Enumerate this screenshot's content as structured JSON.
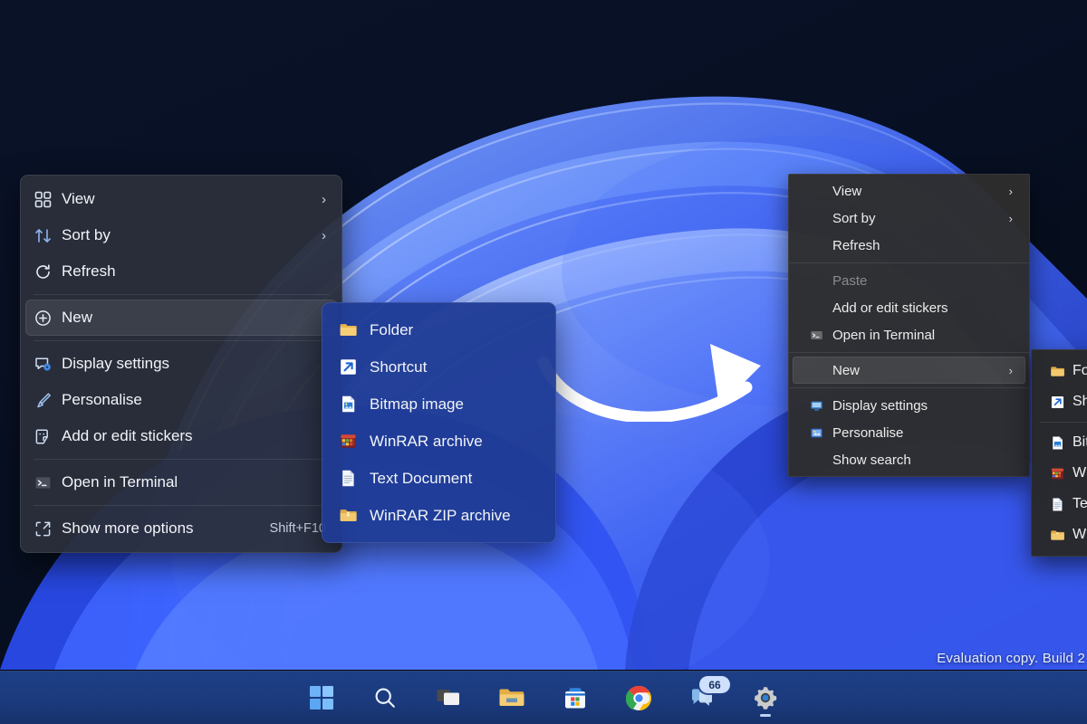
{
  "desktop": {
    "wallpaper_name": "windows-11-bloom-wallpaper",
    "watermark": "Evaluation copy. Build 2",
    "annotation_arrow": "curved-arrow-annotation"
  },
  "colors": {
    "menu_dark": "#2b2f3a",
    "menu_blue": "#1f3b93",
    "menu_classic": "#2d2d2d",
    "taskbar": "#1d3f86",
    "accent": "#4a7cf0",
    "text": "#f2f4f8",
    "disabled_text": "#8a8a8a",
    "folder_yellow": "#f5c257"
  },
  "context_menu": {
    "name": "desktop-context-menu",
    "groups": [
      {
        "items": [
          {
            "label": "View",
            "icon": "grid-view-icon",
            "submenu": true,
            "shortcut": "",
            "disabled": false,
            "selected": false
          },
          {
            "label": "Sort by",
            "icon": "sort-icon",
            "submenu": true,
            "shortcut": "",
            "disabled": false,
            "selected": false
          },
          {
            "label": "Refresh",
            "icon": "refresh-icon",
            "submenu": false,
            "shortcut": "",
            "disabled": false,
            "selected": false
          }
        ]
      },
      {
        "items": [
          {
            "label": "New",
            "icon": "plus-circle-icon",
            "submenu": true,
            "shortcut": "",
            "disabled": false,
            "selected": true
          }
        ]
      },
      {
        "items": [
          {
            "label": "Display settings",
            "icon": "monitor-settings-icon",
            "submenu": false,
            "shortcut": "",
            "disabled": false,
            "selected": false
          },
          {
            "label": "Personalise",
            "icon": "paintbrush-icon",
            "submenu": false,
            "shortcut": "",
            "disabled": false,
            "selected": false
          },
          {
            "label": "Add or edit stickers",
            "icon": "sticker-icon",
            "submenu": false,
            "shortcut": "",
            "disabled": false,
            "selected": false
          }
        ]
      },
      {
        "items": [
          {
            "label": "Open in Terminal",
            "icon": "terminal-icon",
            "submenu": false,
            "shortcut": "",
            "disabled": false,
            "selected": false
          }
        ]
      },
      {
        "items": [
          {
            "label": "Show more options",
            "icon": "show-more-options-icon",
            "submenu": false,
            "shortcut": "Shift+F10",
            "disabled": false,
            "selected": false
          }
        ]
      }
    ]
  },
  "new_submenu": {
    "name": "new-submenu",
    "items": [
      {
        "label": "Folder",
        "icon": "folder-icon"
      },
      {
        "label": "Shortcut",
        "icon": "shortcut-icon"
      },
      {
        "label": "Bitmap image",
        "icon": "bitmap-image-icon"
      },
      {
        "label": "WinRAR archive",
        "icon": "winrar-archive-icon"
      },
      {
        "label": "Text Document",
        "icon": "text-document-icon"
      },
      {
        "label": "WinRAR ZIP archive",
        "icon": "winrar-zip-icon"
      }
    ]
  },
  "classic_menu": {
    "name": "classic-context-menu",
    "groups": [
      {
        "items": [
          {
            "label": "View",
            "icon": "",
            "submenu": true,
            "disabled": false,
            "selected": false
          },
          {
            "label": "Sort by",
            "icon": "",
            "submenu": true,
            "disabled": false,
            "selected": false
          },
          {
            "label": "Refresh",
            "icon": "",
            "submenu": false,
            "disabled": false,
            "selected": false
          }
        ]
      },
      {
        "items": [
          {
            "label": "Paste",
            "icon": "",
            "submenu": false,
            "disabled": true,
            "selected": false
          },
          {
            "label": "Add or edit stickers",
            "icon": "",
            "submenu": false,
            "disabled": false,
            "selected": false
          },
          {
            "label": "Open in Terminal",
            "icon": "terminal-icon",
            "submenu": false,
            "disabled": false,
            "selected": false
          }
        ]
      },
      {
        "items": [
          {
            "label": "New",
            "icon": "",
            "submenu": true,
            "disabled": false,
            "selected": true
          }
        ]
      },
      {
        "items": [
          {
            "label": "Display settings",
            "icon": "monitor-settings-icon",
            "submenu": false,
            "disabled": false,
            "selected": false
          },
          {
            "label": "Personalise",
            "icon": "personalise-icon",
            "submenu": false,
            "disabled": false,
            "selected": false
          },
          {
            "label": "Show search",
            "icon": "",
            "submenu": false,
            "disabled": false,
            "selected": false
          }
        ]
      }
    ]
  },
  "classic_new_submenu": {
    "name": "classic-new-submenu",
    "items": [
      {
        "label": "Folder",
        "icon": "folder-icon"
      },
      {
        "label": "Shortcut",
        "icon": "shortcut-icon"
      },
      {
        "label": "Bitmap image",
        "icon": "bitmap-image-icon"
      },
      {
        "label": "WinRAR archive",
        "icon": "winrar-archive-icon"
      },
      {
        "label": "Text Document",
        "icon": "text-document-icon"
      },
      {
        "label": "WinRAR ZIP archive",
        "icon": "winrar-zip-icon"
      }
    ]
  },
  "taskbar": {
    "name": "taskbar",
    "items": [
      {
        "icon": "windows-start-icon",
        "label": "Start",
        "badge": "",
        "running": false
      },
      {
        "icon": "search-icon",
        "label": "Search",
        "badge": "",
        "running": false
      },
      {
        "icon": "task-view-icon",
        "label": "Task View",
        "badge": "",
        "running": false
      },
      {
        "icon": "file-explorer-icon",
        "label": "File Explorer",
        "badge": "",
        "running": false
      },
      {
        "icon": "microsoft-store-icon",
        "label": "Microsoft Store",
        "badge": "",
        "running": false
      },
      {
        "icon": "chrome-icon",
        "label": "Google Chrome",
        "badge": "",
        "running": false
      },
      {
        "icon": "teams-chat-icon",
        "label": "Chat",
        "badge": "66",
        "running": false
      },
      {
        "icon": "settings-gear-icon",
        "label": "Settings",
        "badge": "",
        "running": true
      }
    ]
  }
}
